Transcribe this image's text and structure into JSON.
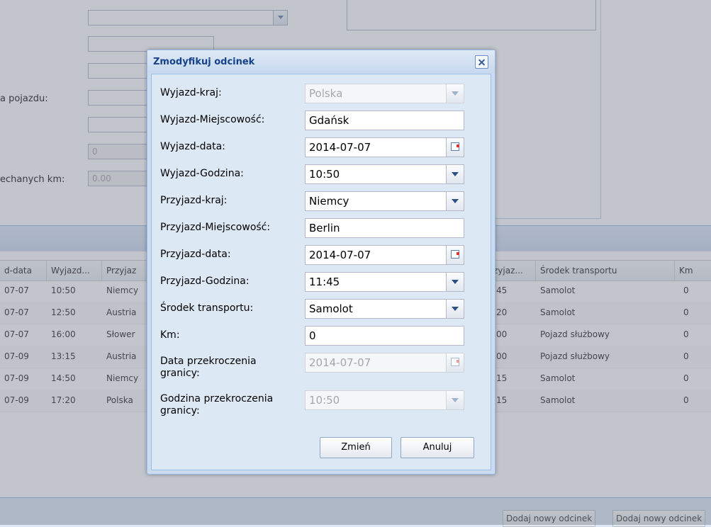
{
  "background": {
    "labels": {
      "vehicle_label": "a pojazdu:",
      "km_label": "echanych km:"
    },
    "fields": {
      "counter_value": "0",
      "km_value": "0.00"
    },
    "grid": {
      "columns": [
        "d-data",
        "Wyjazd...",
        "Przyjaz",
        "zyjaz...",
        "Środek transportu",
        "Km"
      ],
      "rows": [
        {
          "date": "07-07",
          "time": "10:50",
          "country": "Niemcy",
          "arr_time": ":45",
          "transport": "Samolot",
          "km": "0"
        },
        {
          "date": "07-07",
          "time": "12:50",
          "country": "Austria",
          "arr_time": ":20",
          "transport": "Samolot",
          "km": "0"
        },
        {
          "date": "07-07",
          "time": "16:00",
          "country": "Słower",
          "arr_time": ":00",
          "transport": "Pojazd służbowy",
          "km": "0"
        },
        {
          "date": "07-09",
          "time": "13:15",
          "country": "Austria",
          "arr_time": ":00",
          "transport": "Pojazd służbowy",
          "km": "0"
        },
        {
          "date": "07-09",
          "time": "14:50",
          "country": "Niemcy",
          "arr_time": ":15",
          "transport": "Samolot",
          "km": "0"
        },
        {
          "date": "07-09",
          "time": "17:20",
          "country": "Polska",
          "arr_time": ":15",
          "transport": "Samolot",
          "km": "0"
        }
      ]
    },
    "footer_buttons": [
      "Dodaj nowy odcinek",
      "Dodaj nowy odcinek"
    ]
  },
  "dialog": {
    "title": "Zmodyfikuj odcinek",
    "fields": [
      {
        "label": "Wyjazd-kraj:",
        "value": "Polska",
        "type": "combo",
        "disabled": true
      },
      {
        "label": "Wyjazd-Miejscowość:",
        "value": "Gdańsk",
        "type": "text",
        "disabled": false
      },
      {
        "label": "Wyjazd-data:",
        "value": "2014-07-07",
        "type": "date",
        "disabled": false
      },
      {
        "label": "Wyjazd-Godzina:",
        "value": "10:50",
        "type": "combo",
        "disabled": false
      },
      {
        "label": "Przyjazd-kraj:",
        "value": "Niemcy",
        "type": "combo",
        "disabled": false
      },
      {
        "label": "Przyjazd-Miejscowość:",
        "value": "Berlin",
        "type": "text",
        "disabled": false
      },
      {
        "label": "Przyjazd-data:",
        "value": "2014-07-07",
        "type": "date",
        "disabled": false
      },
      {
        "label": "Przyjazd-Godzina:",
        "value": "11:45",
        "type": "combo",
        "disabled": false
      },
      {
        "label": "Środek transportu:",
        "value": "Samolot",
        "type": "combo",
        "disabled": false
      },
      {
        "label": "Km:",
        "value": "0",
        "type": "text",
        "disabled": false
      },
      {
        "label_line1": "Data przekroczenia",
        "label_line2": "granicy:",
        "value": "2014-07-07",
        "type": "date",
        "disabled": true
      },
      {
        "label_line1": "Godzina przekroczenia",
        "label_line2": "granicy:",
        "value": "10:50",
        "type": "combo",
        "disabled": true
      }
    ],
    "buttons": {
      "change": "Zmień",
      "cancel": "Anuluj"
    }
  }
}
